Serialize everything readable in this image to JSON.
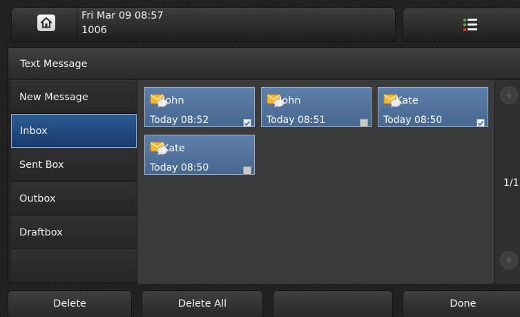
{
  "status_bar": {
    "datetime": "Fri Mar 09 08:57",
    "extension": "1006",
    "home_icon": "home-icon",
    "menu_icon": "menu-list-icon"
  },
  "window": {
    "title": "Text Message"
  },
  "sidebar": {
    "items": [
      {
        "label": "New Message",
        "active": false
      },
      {
        "label": "Inbox",
        "active": true
      },
      {
        "label": "Sent Box",
        "active": false
      },
      {
        "label": "Outbox",
        "active": false
      },
      {
        "label": "Draftbox",
        "active": false
      }
    ]
  },
  "messages": [
    {
      "sender": "John",
      "time": "Today 08:52",
      "checked": true,
      "icon": "envelope-speech-icon"
    },
    {
      "sender": "John",
      "time": "Today 08:51",
      "checked": false,
      "icon": "envelope-speech-icon"
    },
    {
      "sender": "Kate",
      "time": "Today 08:50",
      "checked": true,
      "icon": "envelope-speech-icon"
    },
    {
      "sender": "Kate",
      "time": "Today 08:50",
      "checked": false,
      "icon": "envelope-speech-icon"
    }
  ],
  "pagination": {
    "page": "1/1"
  },
  "softkeys": {
    "key1": "Delete",
    "key2": "Delete All",
    "key3": "",
    "key4": "Done"
  },
  "colors": {
    "selected_item": "#1f4b82",
    "message_card": "#50729c",
    "background": "#242424"
  }
}
